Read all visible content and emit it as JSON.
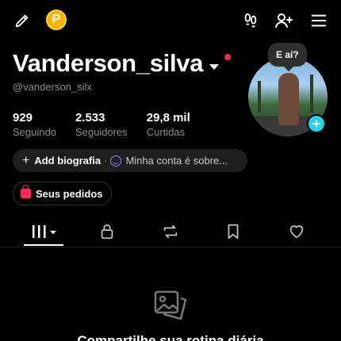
{
  "profile": {
    "username": "Vanderson_silva",
    "handle": "@vanderson_silx",
    "stats": [
      {
        "value": "929",
        "label": "Seguindo"
      },
      {
        "value": "2.533",
        "label": "Seguidores"
      },
      {
        "value": "29,8 mil",
        "label": "Curtidas"
      }
    ],
    "bubble_text": "E aí?",
    "coin_label": "P"
  },
  "bio": {
    "add_label": "Add biografia",
    "separator": "·",
    "about_text": "Minha conta é sobre..."
  },
  "orders": {
    "label": "Seus pedidos"
  },
  "empty_state": {
    "title": "Compartilhe sua rotina diária"
  },
  "icons": {
    "edit": "pencil-icon",
    "coin": "coin-icon",
    "footprints": "footprints-icon",
    "add_user": "add-user-icon",
    "menu": "menu-icon",
    "videos_tab": "grid-icon",
    "private_tab": "lock-icon",
    "reposts_tab": "repost-icon",
    "favorites_tab": "bookmark-icon",
    "liked_tab": "heart-icon"
  },
  "colors": {
    "background": "#000000",
    "accent_red": "#fe2c55",
    "accent_cyan": "#20d5ec",
    "coin": "#ffb300"
  }
}
